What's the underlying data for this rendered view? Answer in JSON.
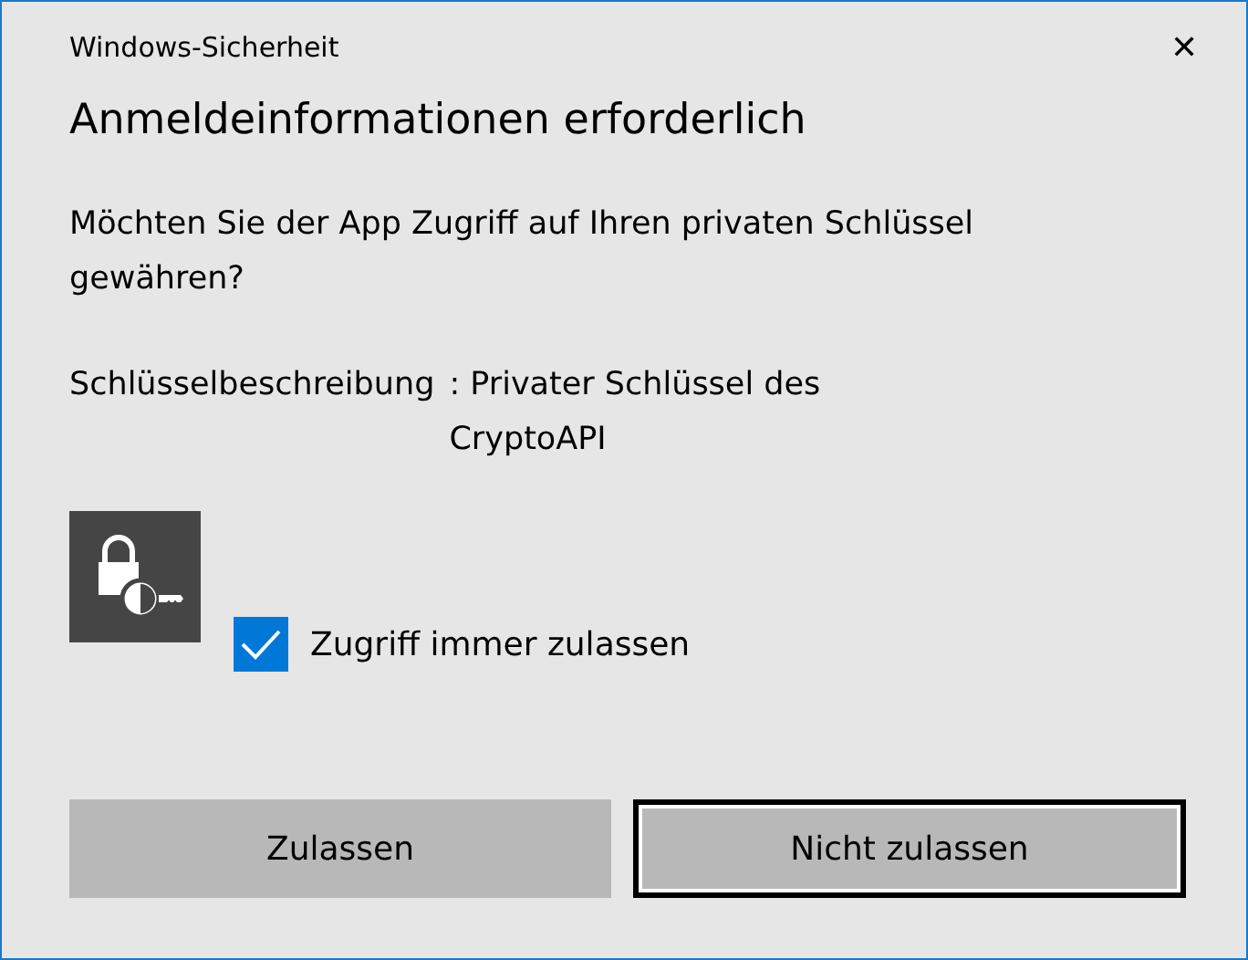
{
  "window": {
    "title": "Windows-Sicherheit",
    "close": "✕"
  },
  "heading": "Anmeldeinformationen erforderlich",
  "message": "Möchten Sie der App Zugriff auf Ihren privaten Schlüssel gewähren?",
  "description": {
    "label": "Schlüsselbeschreibung",
    "value": ": Privater Schlüssel des CryptoAPI"
  },
  "checkbox": {
    "label": "Zugriff immer zulassen",
    "checked": true
  },
  "buttons": [
    {
      "label": "Zulassen",
      "focused": false
    },
    {
      "label": "Nicht zulassen",
      "focused": true
    }
  ]
}
